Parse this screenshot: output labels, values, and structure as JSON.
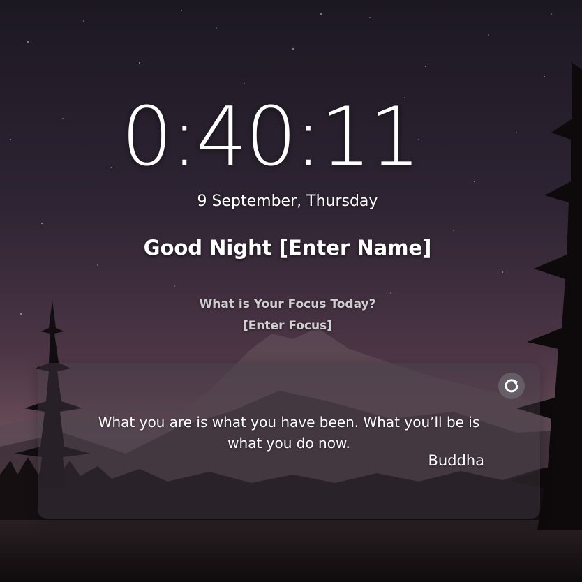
{
  "clock": {
    "time": "0:40:11"
  },
  "date": {
    "text": "9 September, Thursday"
  },
  "greeting": {
    "salutation": "Good Night",
    "name": "[Enter Name]"
  },
  "focus": {
    "question": "What is Your Focus Today?",
    "value": "[Enter Focus]"
  },
  "quote": {
    "text": "What you are is what you have been. What you’ll be is what you do now.",
    "author": "Buddha",
    "refresh_icon": "refresh-icon"
  },
  "background": {
    "scene": "starry-night-mountain-lake"
  }
}
